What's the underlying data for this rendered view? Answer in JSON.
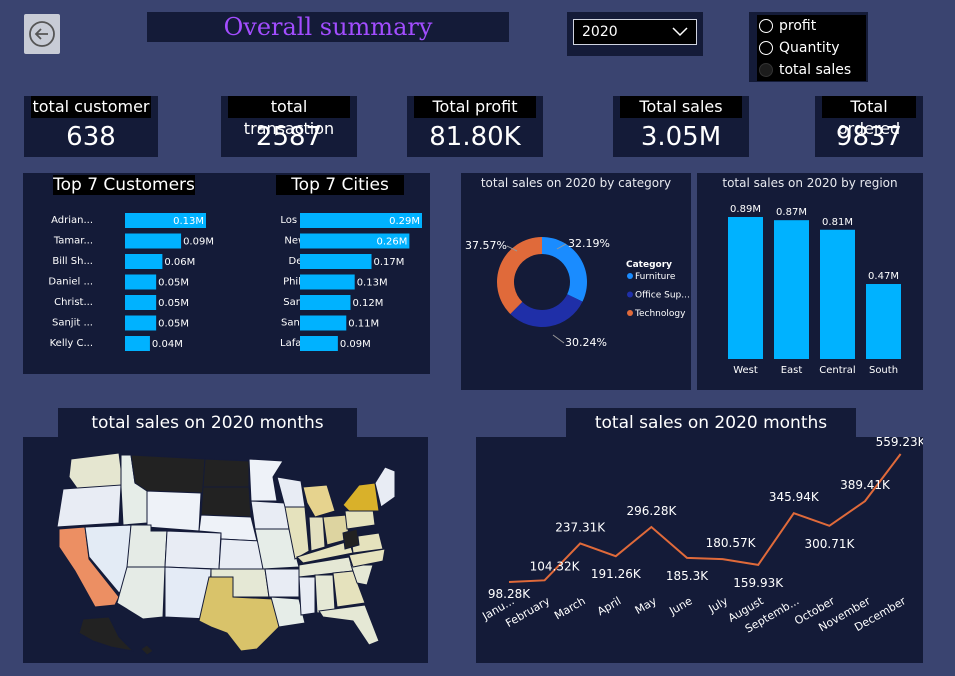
{
  "header": {
    "title": "Overall summary",
    "year": "2020",
    "radio_options": [
      {
        "label": "profit",
        "selected": false
      },
      {
        "label": "Quantity",
        "selected": false
      },
      {
        "label": "total sales",
        "selected": true
      }
    ]
  },
  "kpis": [
    {
      "label": "total customer",
      "value": "638"
    },
    {
      "label": "total transaction",
      "value": "2587"
    },
    {
      "label": "Total profit",
      "value": "81.80K"
    },
    {
      "label": "Total sales",
      "value": "3.05M"
    },
    {
      "label": "Total ordered",
      "value": "9837"
    }
  ],
  "top_customers": {
    "title": "Top 7 Customers",
    "labels": [
      "Adrian...",
      "Tamar...",
      "Bill Sh...",
      "Daniel ...",
      "Christ...",
      "Sanjit ...",
      "Kelly C..."
    ],
    "value_labels": [
      "0.13M",
      "0.09M",
      "0.06M",
      "0.05M",
      "0.05M",
      "0.05M",
      "0.04M"
    ],
    "values": [
      0.13,
      0.09,
      0.06,
      0.05,
      0.05,
      0.05,
      0.04
    ]
  },
  "top_cities": {
    "title": "Top 7 Cities",
    "labels": [
      "Los An...",
      "New Y...",
      "Detroit",
      "Philad...",
      "San Fr...",
      "San Di...",
      "Lafaye..."
    ],
    "value_labels": [
      "0.29M",
      "0.26M",
      "0.17M",
      "0.13M",
      "0.12M",
      "0.11M",
      "0.09M"
    ],
    "values": [
      0.29,
      0.26,
      0.17,
      0.13,
      0.12,
      0.11,
      0.09
    ]
  },
  "category_chart": {
    "title": "total sales on 2020 by category",
    "legend_title": "Category",
    "slices": [
      {
        "name": "Furniture",
        "pct": 32.19,
        "label": "32.19%",
        "color": "#1a8cff"
      },
      {
        "name": "Office Sup...",
        "pct": 30.24,
        "label": "30.24%",
        "color": "#1f2fa8"
      },
      {
        "name": "Technology",
        "pct": 37.57,
        "label": "37.57%",
        "color": "#e06a3a"
      }
    ]
  },
  "region_chart": {
    "title": "total sales on 2020 by region",
    "categories": [
      "West",
      "East",
      "Central",
      "South"
    ],
    "values": [
      0.89,
      0.87,
      0.81,
      0.47
    ],
    "value_labels": [
      "0.89M",
      "0.87M",
      "0.81M",
      "0.47M"
    ],
    "color": "#00b2ff"
  },
  "map": {
    "title": "total sales on 2020 months"
  },
  "line_chart": {
    "title": "total sales on 2020 months",
    "categories": [
      "Janu...",
      "February",
      "March",
      "April",
      "May",
      "June",
      "July",
      "August",
      "Septemb...",
      "October",
      "November",
      "December"
    ],
    "values": [
      98.28,
      104.32,
      237.31,
      191.26,
      296.28,
      185.3,
      180.57,
      159.93,
      345.94,
      300.71,
      389.41,
      559.23
    ],
    "value_labels": [
      "98.28K",
      "104.32K",
      "237.31K",
      "191.26K",
      "296.28K",
      "185.3K",
      "180.57K",
      "159.93K",
      "345.94K",
      "300.71K",
      "389.41K",
      "559.23K"
    ],
    "color": "#e06a3a"
  },
  "colors": {
    "background": "#3a4470",
    "panel": "#141b38",
    "bar": "#00b2ff",
    "title": "#a24dff"
  }
}
